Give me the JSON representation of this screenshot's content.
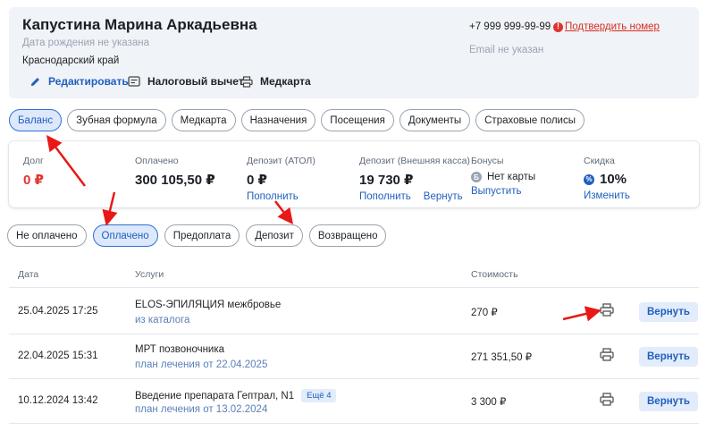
{
  "patient": {
    "name": "Капустина Марина Аркадьевна",
    "dob": "Дата рождения не указана",
    "region": "Краснодарский край",
    "phone": "+7 999 999-99-99",
    "confirm_phone": "Подтвердить номер",
    "email": "Email не указан",
    "actions": {
      "edit": "Редактировать",
      "tax": "Налоговый вычет",
      "medcard": "Медкарта"
    }
  },
  "tabs": [
    "Баланс",
    "Зубная формула",
    "Медкарта",
    "Назначения",
    "Посещения",
    "Документы",
    "Страховые полисы"
  ],
  "active_tab": "Баланс",
  "balance": {
    "debt": {
      "label": "Долг",
      "value": "0 ₽"
    },
    "paid": {
      "label": "Оплачено",
      "value": "300 105,50 ₽"
    },
    "deposit_atol": {
      "label": "Депозит (АТОЛ)",
      "value": "0 ₽",
      "link": "Пополнить"
    },
    "deposit_ext": {
      "label": "Депозит (Внешняя касса)",
      "value": "19 730 ₽",
      "link1": "Пополнить",
      "link2": "Вернуть"
    },
    "bonus": {
      "label": "Бонусы",
      "value": "Нет карты",
      "link": "Выпустить",
      "icon_letter": "Б"
    },
    "discount": {
      "label": "Скидка",
      "value": "10%",
      "link": "Изменить",
      "icon_glyph": "%"
    }
  },
  "filters": [
    "Не оплачено",
    "Оплачено",
    "Предоплата",
    "Депозит",
    "Возвращено"
  ],
  "active_filter": "Оплачено",
  "table": {
    "headers": {
      "date": "Дата",
      "service": "Услуги",
      "cost": "Стоимость"
    },
    "rows": [
      {
        "date": "25.04.2025 17:25",
        "service": "ELOS-ЭПИЛЯЦИЯ межбровье",
        "sub": "из каталога",
        "cost": "270 ₽",
        "action": "Вернуть"
      },
      {
        "date": "22.04.2025 15:31",
        "service": "МРТ позвоночника",
        "sub": "план лечения от 22.04.2025",
        "cost": "271 351,50 ₽",
        "action": "Вернуть"
      },
      {
        "date": "10.12.2024 13:42",
        "service": "Введение препарата Гептрал, N1",
        "badge": "Ещё 4",
        "sub": "план лечения от 13.02.2024",
        "cost": "3 300 ₽",
        "action": "Вернуть"
      }
    ]
  },
  "colors": {
    "accent": "#1f5fbf",
    "danger": "#e0332f",
    "active_bg": "#dde8fb",
    "card_bg": "#f0f3f8",
    "annotation": "#e81818"
  }
}
